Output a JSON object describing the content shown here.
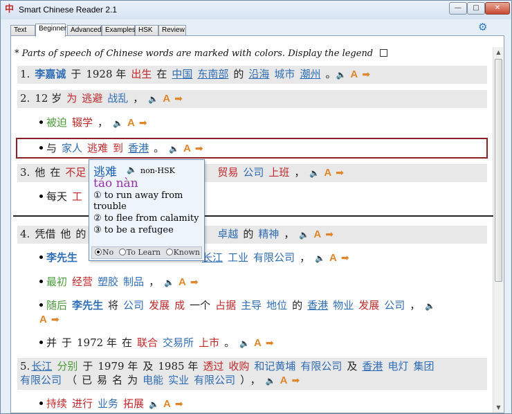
{
  "window": {
    "title": "Smart Chinese Reader 2.1",
    "min": "—",
    "max": "□",
    "close": "✕"
  },
  "tabs": [
    "Text",
    "Beginner",
    "Advanced",
    "Examples",
    "HSK",
    "Review"
  ],
  "active_tab": "Beginner",
  "legend": {
    "text": "* Parts of speech of Chinese words are marked with colors. Display the legend"
  },
  "controls": {
    "speak": "🔈",
    "annotate": "A",
    "arrow": "➡"
  },
  "sentences": {
    "s1": {
      "num": "1.",
      "w": [
        "李嘉诚",
        "于",
        "1928",
        "年",
        "出生",
        "在",
        "中国",
        "东南部",
        "的",
        "沿海",
        "城市",
        "潮州",
        "。"
      ]
    },
    "s2": {
      "num": "2.",
      "w": [
        "12",
        "岁",
        "为",
        "逃避",
        "战乱",
        "，"
      ]
    },
    "s2a": {
      "w": [
        "被迫",
        "辍学",
        "，"
      ]
    },
    "s2b": {
      "w": [
        "与",
        "家人",
        "逃难",
        "到",
        "香港",
        "。"
      ]
    },
    "s3": {
      "num": "3.",
      "w": [
        "他",
        "在",
        "不足",
        "贸易",
        "公司",
        "上班",
        "，"
      ]
    },
    "s3a": {
      "w": [
        "每天",
        "工"
      ]
    },
    "s4": {
      "num": "4.",
      "w": [
        "凭借",
        "他",
        "的",
        "卓越",
        "的",
        "精神",
        "，"
      ]
    },
    "s4a": {
      "w": [
        "李先生",
        "长江",
        "工业",
        "有限公司",
        "，"
      ]
    },
    "s4b": {
      "w": [
        "最初",
        "经营",
        "塑胶",
        "制品",
        "，"
      ]
    },
    "s4c": {
      "w": [
        "随后",
        "李先生",
        "将",
        "公司",
        "发展",
        "成",
        "一个",
        "占据",
        "主导",
        "地位",
        "的",
        "香港",
        "物业",
        "发展",
        "公司",
        "，"
      ]
    },
    "s4d": {
      "w": [
        "并",
        "于",
        "1972",
        "年",
        "在",
        "联合",
        "交易所",
        "上市",
        "。"
      ]
    },
    "s5": {
      "num": "5.",
      "w": [
        "长江",
        "分别",
        "于",
        "1979",
        "年",
        "及",
        "1985",
        "年",
        "透过",
        "收购",
        "和记黄埔",
        "有限公司",
        "及",
        "香港",
        "电灯",
        "集团"
      ]
    },
    "s5b": {
      "w": [
        "有限公司",
        "（",
        "已",
        "易",
        "名",
        "为",
        "电能",
        "实业",
        "有限公司",
        "）",
        "，"
      ]
    },
    "s5c": {
      "w": [
        "持续",
        "进行",
        "业务",
        "拓展"
      ]
    }
  },
  "popup": {
    "word": "逃难",
    "hsk": "non-HSK",
    "pinyin": "táo nàn",
    "defs": [
      "① to run away from trouble",
      "② to flee from calamity",
      "③ to be a refugee"
    ],
    "options": [
      "No",
      "To Learn",
      "Known"
    ],
    "selected": "No"
  }
}
